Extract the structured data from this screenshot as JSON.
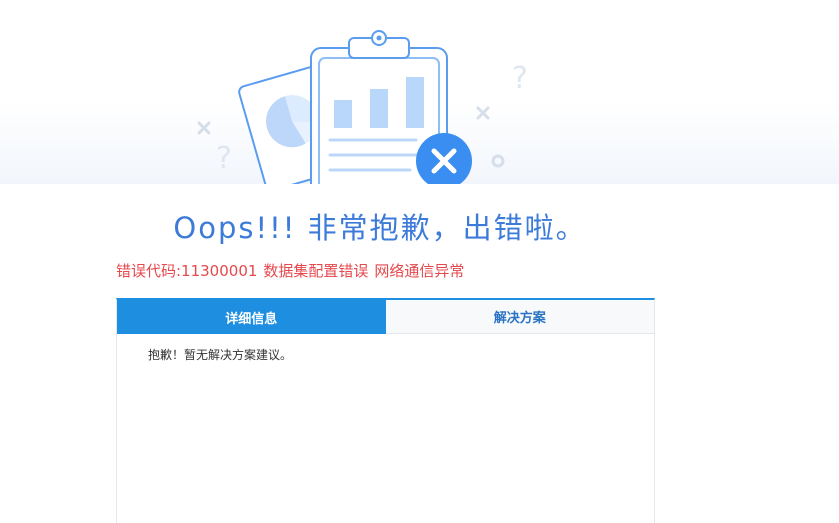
{
  "page": {
    "title": "Oops!!! 非常抱歉，出错啦。",
    "error": {
      "code_label": "错误代码:11300001",
      "message": "数据集配置错误",
      "detail": "网络通信异常"
    },
    "tabs": [
      {
        "label": "详细信息",
        "active": true
      },
      {
        "label": "解决方案",
        "active": false
      }
    ],
    "tab_content": "抱歉！暂无解决方案建议。"
  },
  "colors": {
    "title": "#3d7bd9",
    "error_text": "#e5484d",
    "tab_active_bg": "#1d8ee0",
    "tab_inactive_text": "#2b73c4"
  },
  "icons": [
    "clipboard-chart-illustration",
    "pie-chart-card",
    "error-x-icon",
    "question-mark-decoration",
    "x-decoration",
    "circle-decoration"
  ]
}
